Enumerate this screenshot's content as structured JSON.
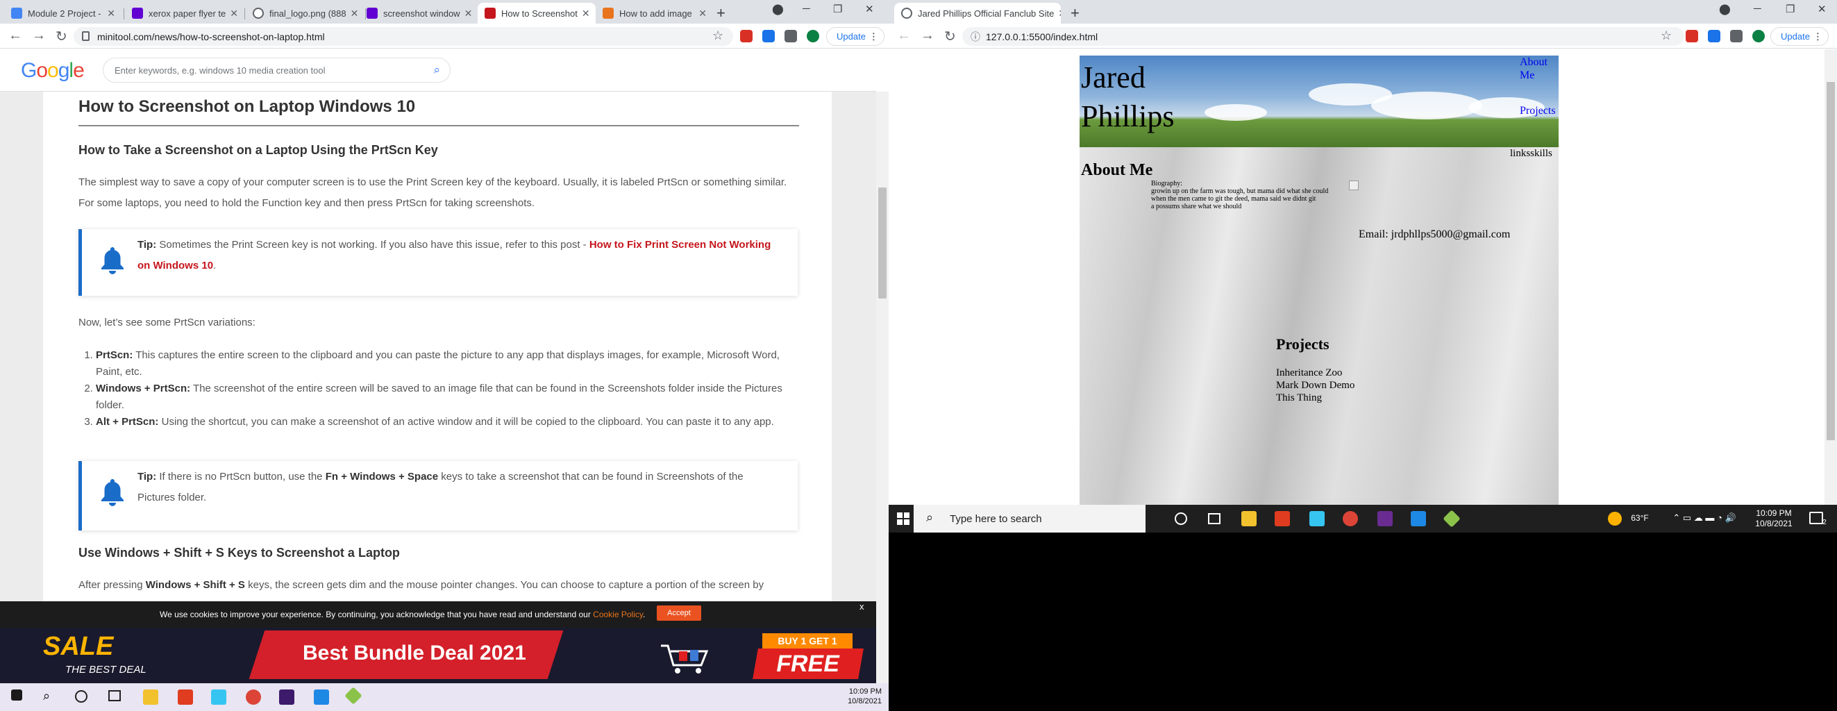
{
  "left_window": {
    "tabs": [
      {
        "label": "Module 2 Project -",
        "color": "#4285f4"
      },
      {
        "label": "xerox paper flyer te",
        "color": "#6001d2"
      },
      {
        "label": "final_logo.png (888",
        "color": "#5f6368"
      },
      {
        "label": "screenshot window",
        "color": "#6001d2"
      },
      {
        "label": "How to Screenshot",
        "color": "#c4161c"
      },
      {
        "label": "How to add image",
        "color": "#e8741e"
      }
    ],
    "url": "minitool.com/news/how-to-screenshot-on-laptop.html",
    "update_label": "Update",
    "search_placeholder": "Enter keywords, e.g. windows 10 media creation tool",
    "google_logo": "Google",
    "article": {
      "title": "How to Screenshot on Laptop Windows 10",
      "h_prtscn": "How to Take a Screenshot on a Laptop Using the PrtScn Key",
      "intro": "The simplest way to save a copy of your computer screen is to use the Print Screen key of the keyboard. Usually, it is labeled PrtScn or something similar. For some laptops, you need to hold the Function key and then press PrtScn for taking screenshots.",
      "tip1_label": "Tip:",
      "tip1_text": " Sometimes the Print Screen key is not working. If you also have this issue, refer to this post - ",
      "tip1_link": "How to Fix Print Screen Not Working on Windows 10",
      "tip1_end": ".",
      "variations": "Now, let’s see some PrtScn variations:",
      "list": [
        {
          "key": "PrtScn:",
          "text": " This captures the entire screen to the clipboard and you can paste the picture to any app that displays images, for example, Microsoft Word, Paint, etc."
        },
        {
          "key": "Windows + PrtScn:",
          "text": " The screenshot of the entire screen will be saved to an image file that can be found in the Screenshots folder inside the Pictures folder."
        },
        {
          "key": "Alt + PrtScn:",
          "text": " Using the shortcut, you can make a screenshot of an active window and it will be copied to the clipboard. You can paste it to any app."
        }
      ],
      "tip2_label": "Tip:",
      "tip2_text_a": " If there is no PrtScn button, use the ",
      "tip2_keys": "Fn + Windows + Space",
      "tip2_text_b": " keys to take a screenshot that can be found in Screenshots of the Pictures folder.",
      "h_winshift": "Use Windows + Shift + S Keys to Screenshot a Laptop",
      "after_a": "After pressing ",
      "after_keys": "Windows + Shift + S",
      "after_b": " keys, the screen gets dim and the mouse pointer changes. You can choose to capture a portion of the screen by dragging and the screenshot is saved to the clipboard which can be pasted to any app."
    },
    "cookie": {
      "message": "We use cookies to improve your experience. By continuing, you acknowledge that you have read and understand our ",
      "policy": "Cookie Policy",
      "end": ".",
      "accept": "Accept",
      "close": "x"
    },
    "banner": {
      "sale": "SALE",
      "best": "THE BEST DEAL",
      "headline": "Best Bundle Deal 2021",
      "b1g1": "BUY 1 GET 1",
      "free": "FREE"
    },
    "taskbar_time": "10:09 PM",
    "taskbar_date": "10/8/2021"
  },
  "right_window": {
    "tab_label": "Jared Phillips Official Fanclub Site",
    "url": "127.0.0.1:5500/index.html",
    "update_label": "Update",
    "site": {
      "title_line1": "Jared",
      "title_line2": "Phillips",
      "nav_about_1": "About",
      "nav_about_2": "Me",
      "nav_projects": "Projects",
      "links_text": "linksskills",
      "about_heading": "About Me",
      "bio_label": "Biography:",
      "bio_line1": "growin up on the farm was tough, but mama did what she could",
      "bio_line2": "when the men came to git the deed, mama said we didnt git",
      "bio_line3": "a possums share what we should",
      "email": "Email: jrdphllps5000@gmail.com",
      "projects_heading": "Projects",
      "projects": [
        "Inheritance Zoo",
        "Mark Down Demo",
        "This Thing"
      ]
    },
    "taskbar": {
      "search_placeholder": "Type here to search",
      "temperature": "63°F",
      "time": "10:09 PM",
      "date": "10/8/2021",
      "notifications": "2"
    }
  },
  "colors": {
    "accent_blue": "#1a6cc9",
    "link_red": "#c4161c",
    "update_blue": "#1a73e8"
  }
}
